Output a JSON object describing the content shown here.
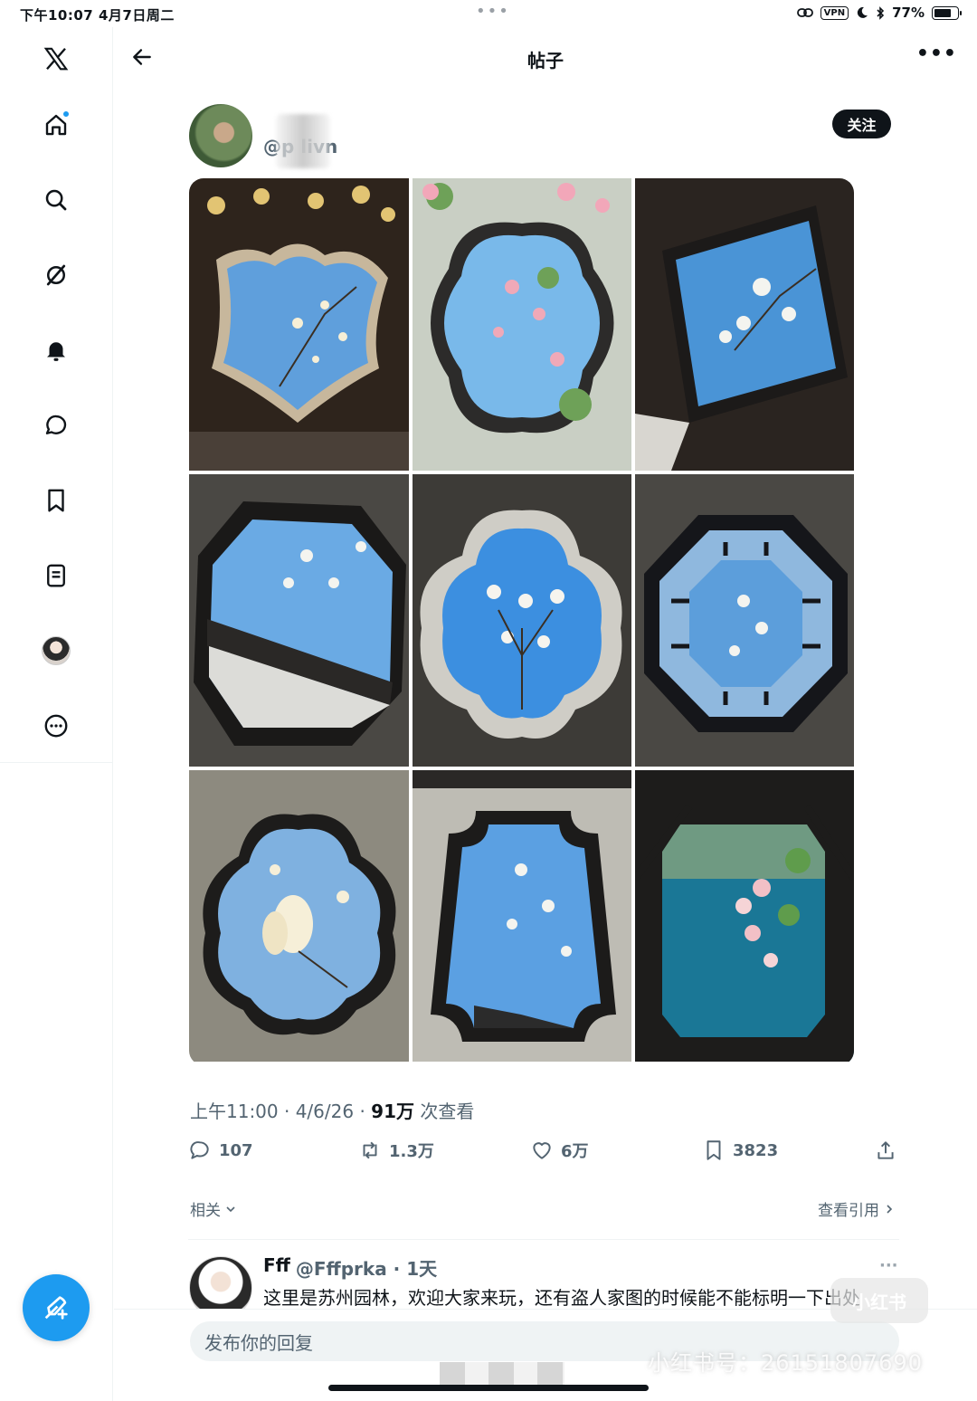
{
  "status_bar": {
    "time": "下午10:07   4月7日周二",
    "vpn": "VPN",
    "battery": "77%",
    "battery_level": 0.77
  },
  "header": {
    "title": "帖子"
  },
  "post": {
    "author_handle": "@p       livn",
    "follow_label": "关注",
    "meta_time": "上午11:00 · 4/6/26 · ",
    "meta_views": "91万",
    "meta_views_suffix": " 次查看",
    "actions": {
      "replies": "107",
      "reposts": "1.3万",
      "likes": "6万",
      "bookmarks": "3823"
    },
    "related_label": "相关",
    "quotes_label": "查看引用"
  },
  "reply": {
    "name": "Fff",
    "handle": "@Fffprka · 1天",
    "text": "这里是苏州园林，欢迎大家来玩，还有盗人家图的时候能不能标明一下出处"
  },
  "composer": {
    "placeholder": "发布你的回复"
  },
  "watermark": {
    "text": "小红书号：26151807690",
    "logo": "小红书"
  },
  "colors": {
    "accent": "#1d9bf0",
    "text": "#0f1419",
    "secondary": "#536471"
  }
}
